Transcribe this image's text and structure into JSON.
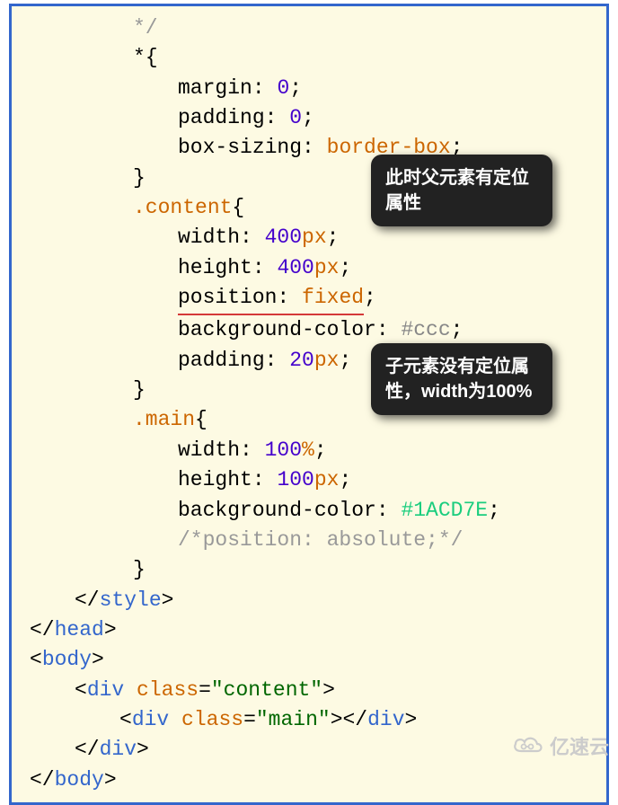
{
  "code": {
    "l1": "*/",
    "l2_sel": "*",
    "l2_brace": "{",
    "l3_prop": "margin",
    "l3_val": "0",
    "l4_prop": "padding",
    "l4_val": "0",
    "l5_prop": "box-sizing",
    "l5_val": "border-box",
    "l6": "}",
    "l7_sel": ".content",
    "l7_brace": "{",
    "l8_prop": "width",
    "l8_val": "400",
    "l8_unit": "px",
    "l9_prop": "height",
    "l9_val": "400",
    "l9_unit": "px",
    "l10_prop": "position",
    "l10_val": "fixed",
    "l11_prop": "background-color",
    "l11_val": "#ccc",
    "l12_prop": "padding",
    "l12_val": "20",
    "l12_unit": "px",
    "l13": "}",
    "l14_sel": ".main",
    "l14_brace": "{",
    "l15_prop": "width",
    "l15_val": "100",
    "l15_unit": "%",
    "l16_prop": "height",
    "l16_val": "100",
    "l16_unit": "px",
    "l17_prop": "background-color",
    "l17_val": "#1ACD7E",
    "l18_comment": "/*position: absolute;*/",
    "l19": "}",
    "l20_tag": "style",
    "l21_tag": "head",
    "l22_tag": "body",
    "l23_tag": "div",
    "l23_attr": "class",
    "l23_val": "\"content\"",
    "l24_tag": "div",
    "l24_attr": "class",
    "l24_val": "\"main\"",
    "l25_tag": "div",
    "l26_tag": "body"
  },
  "tooltip": {
    "t1": "此时父元素有定位属性",
    "t2": "子元素没有定位属性，width为100%"
  },
  "watermark": {
    "text": "亿速云"
  }
}
